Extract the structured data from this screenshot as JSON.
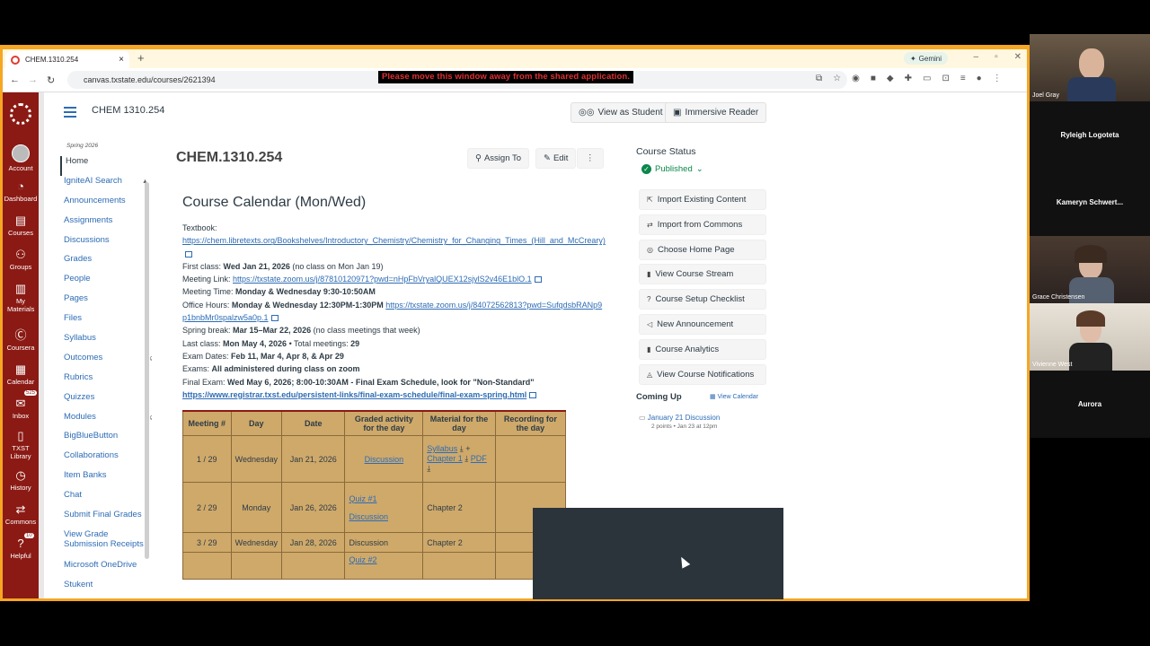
{
  "browser": {
    "tab_title": "CHEM.1310.254",
    "new_tab": "+",
    "gemini_label": "Gemini",
    "url": "canvas.txstate.edu/courses/2621394",
    "share_warning": "Please move this window away from the shared application.",
    "accent_color": "#f5a623"
  },
  "global_nav": {
    "items": [
      {
        "label": "Account",
        "icon": "avatar-icon"
      },
      {
        "label": "Dashboard",
        "icon": "dashboard-icon"
      },
      {
        "label": "Courses",
        "icon": "courses-icon"
      },
      {
        "label": "Groups",
        "icon": "groups-icon"
      },
      {
        "label": "My Materials",
        "icon": "materials-icon"
      },
      {
        "label": "Coursera",
        "icon": "coursera-icon"
      },
      {
        "label": "Calendar",
        "icon": "calendar-icon"
      },
      {
        "label": "Inbox",
        "icon": "inbox-icon",
        "badge": "525"
      },
      {
        "label": "TXST Library",
        "icon": "library-icon"
      },
      {
        "label": "History",
        "icon": "history-icon"
      },
      {
        "label": "Commons",
        "icon": "commons-icon"
      },
      {
        "label": "Helpful",
        "icon": "help-icon",
        "badge": "10"
      }
    ],
    "brand_color": "#8b1a14"
  },
  "header": {
    "course_name": "CHEM 1310.254",
    "view_as_student": "View as Student",
    "immersive_reader": "Immersive Reader"
  },
  "course_nav": {
    "term": "Spring 2026",
    "items": [
      {
        "label": "Home",
        "active": true
      },
      {
        "label": "IgniteAI Search"
      },
      {
        "label": "Announcements"
      },
      {
        "label": "Assignments"
      },
      {
        "label": "Discussions"
      },
      {
        "label": "Grades"
      },
      {
        "label": "People"
      },
      {
        "label": "Pages"
      },
      {
        "label": "Files"
      },
      {
        "label": "Syllabus"
      },
      {
        "label": "Outcomes",
        "hidden": true
      },
      {
        "label": "Rubrics"
      },
      {
        "label": "Quizzes"
      },
      {
        "label": "Modules",
        "hidden": true
      },
      {
        "label": "BigBlueButton"
      },
      {
        "label": "Collaborations"
      },
      {
        "label": "Item Banks"
      },
      {
        "label": "Chat"
      },
      {
        "label": "Submit Final Grades"
      },
      {
        "label": "View Grade Submission Receipts"
      },
      {
        "label": "Microsoft OneDrive"
      },
      {
        "label": "Stukent"
      }
    ]
  },
  "main": {
    "page_title": "CHEM.1310.254",
    "assign_to": "Assign To",
    "edit": "Edit",
    "more": "⋮",
    "calendar_title": "Course Calendar (Mon/Wed)",
    "textbook_label": "Textbook:",
    "textbook_link": "https://chem.libretexts.org/Bookshelves/Introductory_Chemistry/Chemistry_for_Changing_Times_(Hill_and_McCreary)",
    "first_class_label": "First class: ",
    "first_class_value": "Wed Jan 21, 2026",
    "first_class_note": " (no class on Mon Jan 19)",
    "meeting_link_label": "Meeting Link: ",
    "meeting_link": "https://txstate.zoom.us/j/87810120971?pwd=nHpFbVryalQUEX12sjylS2v46E1blO.1",
    "meeting_time_label": "Meeting Time: ",
    "meeting_time_value": "Monday & Wednesday 9:30-10:50AM",
    "office_hours_label": "Office Hours: ",
    "office_hours_value": "Monday & Wednesday 12:30PM-1:30PM ",
    "office_hours_link": "https://txstate.zoom.us/j/84072562813?pwd=SufqdsbRANp9p1bnbMr0spalzw5a0p.1",
    "spring_break_label": "Spring break: ",
    "spring_break_value": "Mar 15–Mar 22, 2026",
    "spring_break_note": " (no class meetings that week)",
    "last_class_label": "Last class: ",
    "last_class_value": "Mon May 4, 2026",
    "total_meetings_label": " • Total meetings: ",
    "total_meetings_value": "29",
    "exam_dates_label": "Exam Dates: ",
    "exam_dates_value": "Feb 11, Mar 4, Apr 8, & Apr 29",
    "exams_label": "Exams: ",
    "exams_value": "All administered during class on zoom",
    "final_exam_label": "Final Exam: ",
    "final_exam_value": "Wed May 6, 2026; 8:00-10:30AM - Final Exam Schedule, look for \"Non-Standard\"",
    "final_exam_link": "https://www.registrar.txst.edu/persistent-links/final-exam-schedule/final-exam-spring.html"
  },
  "table": {
    "headers": [
      "Meeting #",
      "Day",
      "Date",
      "Graded activity for the day",
      "Material for the day",
      "Recording for the day"
    ],
    "rows": [
      {
        "meeting": "1 / 29",
        "day": "Wednesday",
        "date": "Jan 21, 2026",
        "activity": "Discussion",
        "material_a": "Syllabus",
        "material_b": "Chapter 1",
        "material_c": "PDF"
      },
      {
        "meeting": "2 / 29",
        "day": "Monday",
        "date": "Jan 26, 2026",
        "activity_a": "Quiz #1",
        "activity_b": "Discussion",
        "material": "Chapter 2"
      },
      {
        "meeting": "3 / 29",
        "day": "Wednesday",
        "date": "Jan 28, 2026",
        "activity": "Discussion",
        "material": "Chapter 2"
      },
      {
        "activity": "Quiz #2"
      }
    ],
    "bg_color": "#cfa96a"
  },
  "sidebar_right": {
    "course_status": "Course Status",
    "published": "Published",
    "buttons": [
      {
        "label": "Import Existing Content",
        "icon": "import-icon"
      },
      {
        "label": "Import from Commons",
        "icon": "commons-icon"
      },
      {
        "label": "Choose Home Page",
        "icon": "target-icon"
      },
      {
        "label": "View Course Stream",
        "icon": "bar-chart-icon"
      },
      {
        "label": "Course Setup Checklist",
        "icon": "question-icon"
      },
      {
        "label": "New Announcement",
        "icon": "announcement-icon"
      },
      {
        "label": "Course Analytics",
        "icon": "bar-chart-icon"
      },
      {
        "label": "View Course Notifications",
        "icon": "bell-icon"
      }
    ],
    "coming_up": "Coming Up",
    "view_calendar": "View Calendar",
    "upcoming_title": "January 21 Discussion",
    "upcoming_meta": "2 points • Jan 23 at 12pm"
  },
  "participants": [
    {
      "name": "Joel Gray",
      "video": true
    },
    {
      "name": "Ryleigh Logoteta",
      "video": false
    },
    {
      "name": "Kameryn  Schwert...",
      "video": false
    },
    {
      "name": "Grace Christensen",
      "video": true
    },
    {
      "name": "Vivienne West",
      "video": true
    },
    {
      "name": "Aurora",
      "video": false
    }
  ]
}
